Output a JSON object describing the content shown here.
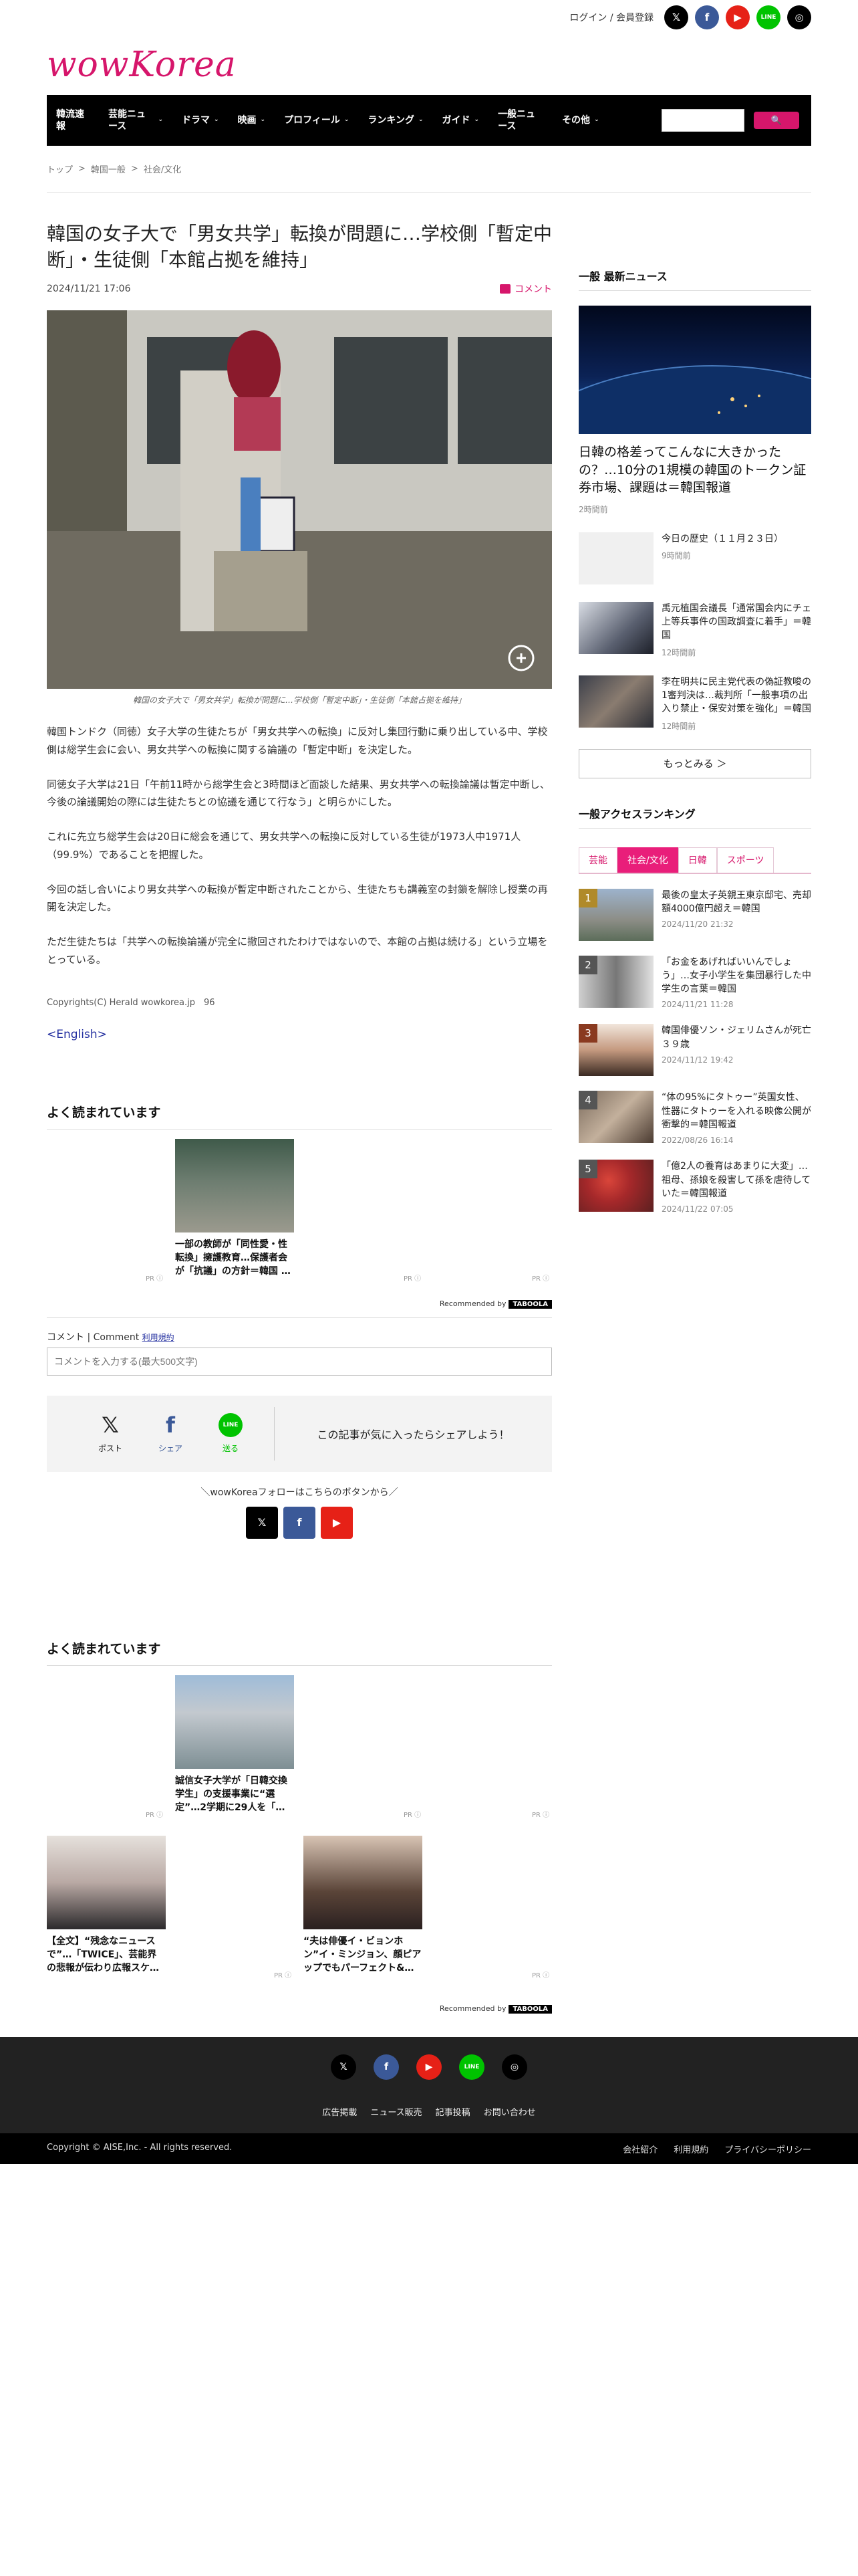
{
  "top": {
    "login": "ログイン / 会員登録",
    "social": [
      "x-icon",
      "facebook-icon",
      "youtube-icon",
      "line-icon",
      "instagram-icon"
    ]
  },
  "logo": "wowKorea",
  "nav": {
    "items": [
      "韓流速報",
      "芸能ニュース",
      "ドラマ",
      "映画",
      "プロフィール",
      "ランキング",
      "ガイド",
      "一般ニュース",
      "その他"
    ],
    "search_button": "🔍"
  },
  "breadcrumb": [
    "トップ",
    "韓国一般",
    "社会/文化"
  ],
  "article": {
    "title": "韓国の女子大で「男女共学」転換が問題に…学校側「暫定中断」・生徒側「本館占拠を維持」",
    "date": "2024/11/21 17:06",
    "comment_link": "コメント",
    "caption": "韓国の女子大で「男女共学」転換が問題に…学校側「暫定中断」・生徒側「本館占拠を維持」",
    "paragraphs": [
      "韓国トンドク（同徳）女子大学の生徒たちが「男女共学への転換」に反対し集団行動に乗り出している中、学校側は総学生会に会い、男女共学への転換に関する論議の「暫定中断」を決定した。",
      "同徳女子大学は21日「午前11時から総学生会と3時間ほど面談した結果、男女共学への転換論議は暫定中断し、今後の論議開始の際には生徒たちとの協議を通じて行なう」と明らかにした。",
      "これに先立ち総学生会は20日に総会を通じて、男女共学への転換に反対している生徒が1973人中1971人（99.9%）であることを把握した。",
      "今回の話し合いにより男女共学への転換が暫定中断されたことから、生徒たちも講義室の封鎖を解除し授業の再開を決定した。",
      "ただ生徒たちは「共学への転換論議が完全に撤回されたわけではないので、本館の占拠は続ける」という立場をとっている。"
    ],
    "copyright": "Copyrights(C) Herald wowkorea.jp　96",
    "english": "<English>"
  },
  "popular1": {
    "heading": "よく読まれています",
    "card_text": "一部の教師が「同性愛・性転換」擁護教育…保護者会が「抗議」の方針＝韓国 …",
    "pr": "PR ⓘ",
    "recommended": "Recommended by",
    "brand": "TABOOLA"
  },
  "comment": {
    "label": "コメント | Comment",
    "rules": "利用規約",
    "placeholder": "コメントを入力する(最大500文字)"
  },
  "share": {
    "post": "ポスト",
    "share": "シェア",
    "send": "送る",
    "line_label": "LINE",
    "message": "この記事が気に入ったらシェアしよう！"
  },
  "follow": {
    "text": "＼wowKoreaフォローはこちらのボタンから／"
  },
  "popular2": {
    "heading": "よく読まれています",
    "cards": [
      "誠信女子大学が「日韓交換学生」の支援事業に“選定”…2学期に29人を「…",
      "【全文】“残念なニュースで”…「TWICE」、芸能界の悲報が伝わり広報スケ…",
      "“夫は俳優イ・ビョンホン”イ・ミンジョン、顔ピアップでもパーフェクト&…"
    ],
    "pr": "PR ⓘ",
    "recommended": "Recommended by",
    "brand": "TABOOLA"
  },
  "sidebar": {
    "latest_heading": "一般 最新ニュース",
    "hero_title": "日韓の格差ってこんなに大きかったの？…10分の1規模の韓国のトークン証券市場、課題は＝韓国報道",
    "hero_time": "2時間前",
    "items": [
      {
        "title": "今日の歴史（１１月２３日）",
        "time": "9時間前"
      },
      {
        "title": "禹元植国会議長「通常国会内にチェ上等兵事件の国政調査に着手」＝韓国",
        "time": "12時間前"
      },
      {
        "title": "李在明共に民主党代表の偽証教唆の1審判決は…裁判所「一般事項の出入り禁止・保安対策を強化」＝韓国",
        "time": "12時間前"
      }
    ],
    "more": "もっとみる ＞",
    "ranking_heading": "一般アクセスランキング",
    "tabs": [
      "芸能",
      "社会/文化",
      "日韓",
      "スポーツ"
    ],
    "ranking": [
      {
        "num": "1",
        "title": "最後の皇太子英親王東京邸宅、売却額4000億円超え＝韓国",
        "time": "2024/11/20 21:32"
      },
      {
        "num": "2",
        "title": "「お金をあげればいいんでしょう」…女子小学生を集団暴行した中学生の言葉＝韓国",
        "time": "2024/11/21 11:28"
      },
      {
        "num": "3",
        "title": "韓国俳優ソン・ジェリムさんが死亡　３９歳",
        "time": "2024/11/12 19:42"
      },
      {
        "num": "4",
        "title": "“体の95%にタトゥー”英国女性、性器にタトゥーを入れる映像公開が衝撃的＝韓国報道",
        "time": "2022/08/26 16:14"
      },
      {
        "num": "5",
        "title": "「億2人の養育はあまりに大変」…祖母、孫娘を殺害して孫を虐待していた＝韓国報道",
        "time": "2024/11/22 07:05"
      }
    ],
    "rank_colors": [
      "#b08a2a",
      "#555555",
      "#8a3a20",
      "#555555",
      "#555555"
    ]
  },
  "footer": {
    "links": [
      "広告掲載",
      "ニュース販売",
      "記事投稿",
      "お問い合わせ"
    ],
    "copyright": "Copyright © AISE,Inc. - All rights reserved.",
    "bottom_links": [
      "会社紹介",
      "利用規約",
      "プライバシーポリシー"
    ]
  }
}
